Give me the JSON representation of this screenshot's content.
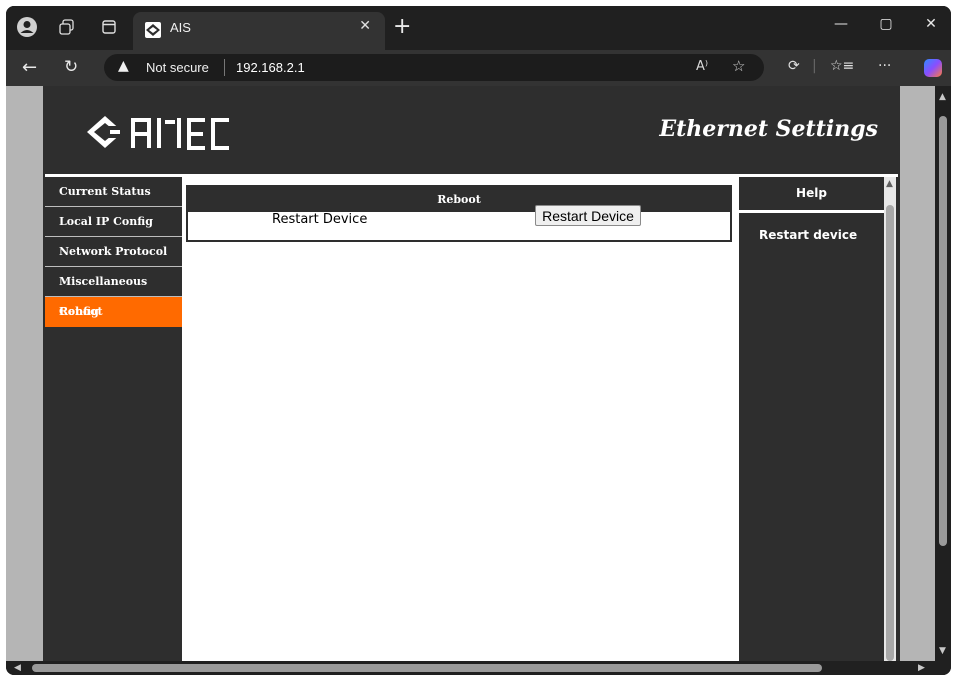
{
  "browser": {
    "tab_title": "AIS",
    "security_label": "Not secure",
    "url": "192.168.2.1",
    "icons": [
      "profile-icon",
      "workspaces-icon",
      "tab-actions-icon",
      "close-tab-icon",
      "new-tab-icon",
      "back-icon",
      "refresh-icon",
      "warning-icon",
      "read-aloud-icon",
      "favorite-icon",
      "extensions-icon",
      "favorites-icon",
      "more-icon",
      "copilot-icon",
      "minimize-icon",
      "maximize-icon",
      "close-window-icon"
    ]
  },
  "header": {
    "title": "Ethernet Settings",
    "logo_text": "AMEC"
  },
  "sidebar": {
    "items": [
      {
        "label": "Current Status"
      },
      {
        "label": "Local IP Config"
      },
      {
        "label": "Network Protocol"
      },
      {
        "label": "Miscellaneous Config"
      },
      {
        "label": "Reboot",
        "active": true
      }
    ],
    "active_color": "#ff6a00"
  },
  "main": {
    "panel_title": "Reboot",
    "row_label": "Restart Device",
    "button_label": "Restart Device"
  },
  "help": {
    "title": "Help",
    "text": "Restart device"
  },
  "colors": {
    "panel_dark": "#2e2e2e",
    "accent": "#ff6a00"
  }
}
